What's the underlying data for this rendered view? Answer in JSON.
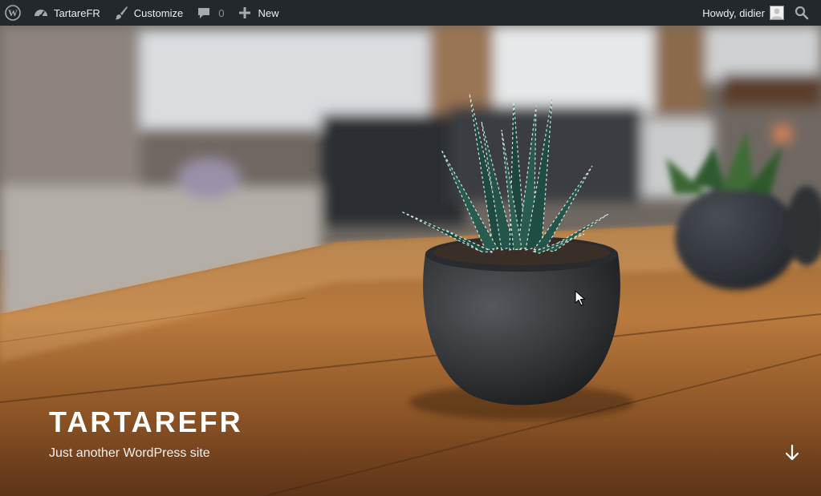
{
  "admin_bar": {
    "wp_logo_icon": "wordpress-logo-icon",
    "site_name": "TartareFR",
    "customize_label": "Customize",
    "comments_count": "0",
    "new_label": "New",
    "howdy_label": "Howdy, didier",
    "search_icon": "search-icon"
  },
  "hero": {
    "site_title": "TARTAREFR",
    "site_description": "Just another WordPress site",
    "scroll_icon": "arrow-down-icon"
  },
  "colors": {
    "admin_bar_bg": "#23282d",
    "admin_bar_text": "#eeeeee",
    "title_text": "#ffffff"
  }
}
